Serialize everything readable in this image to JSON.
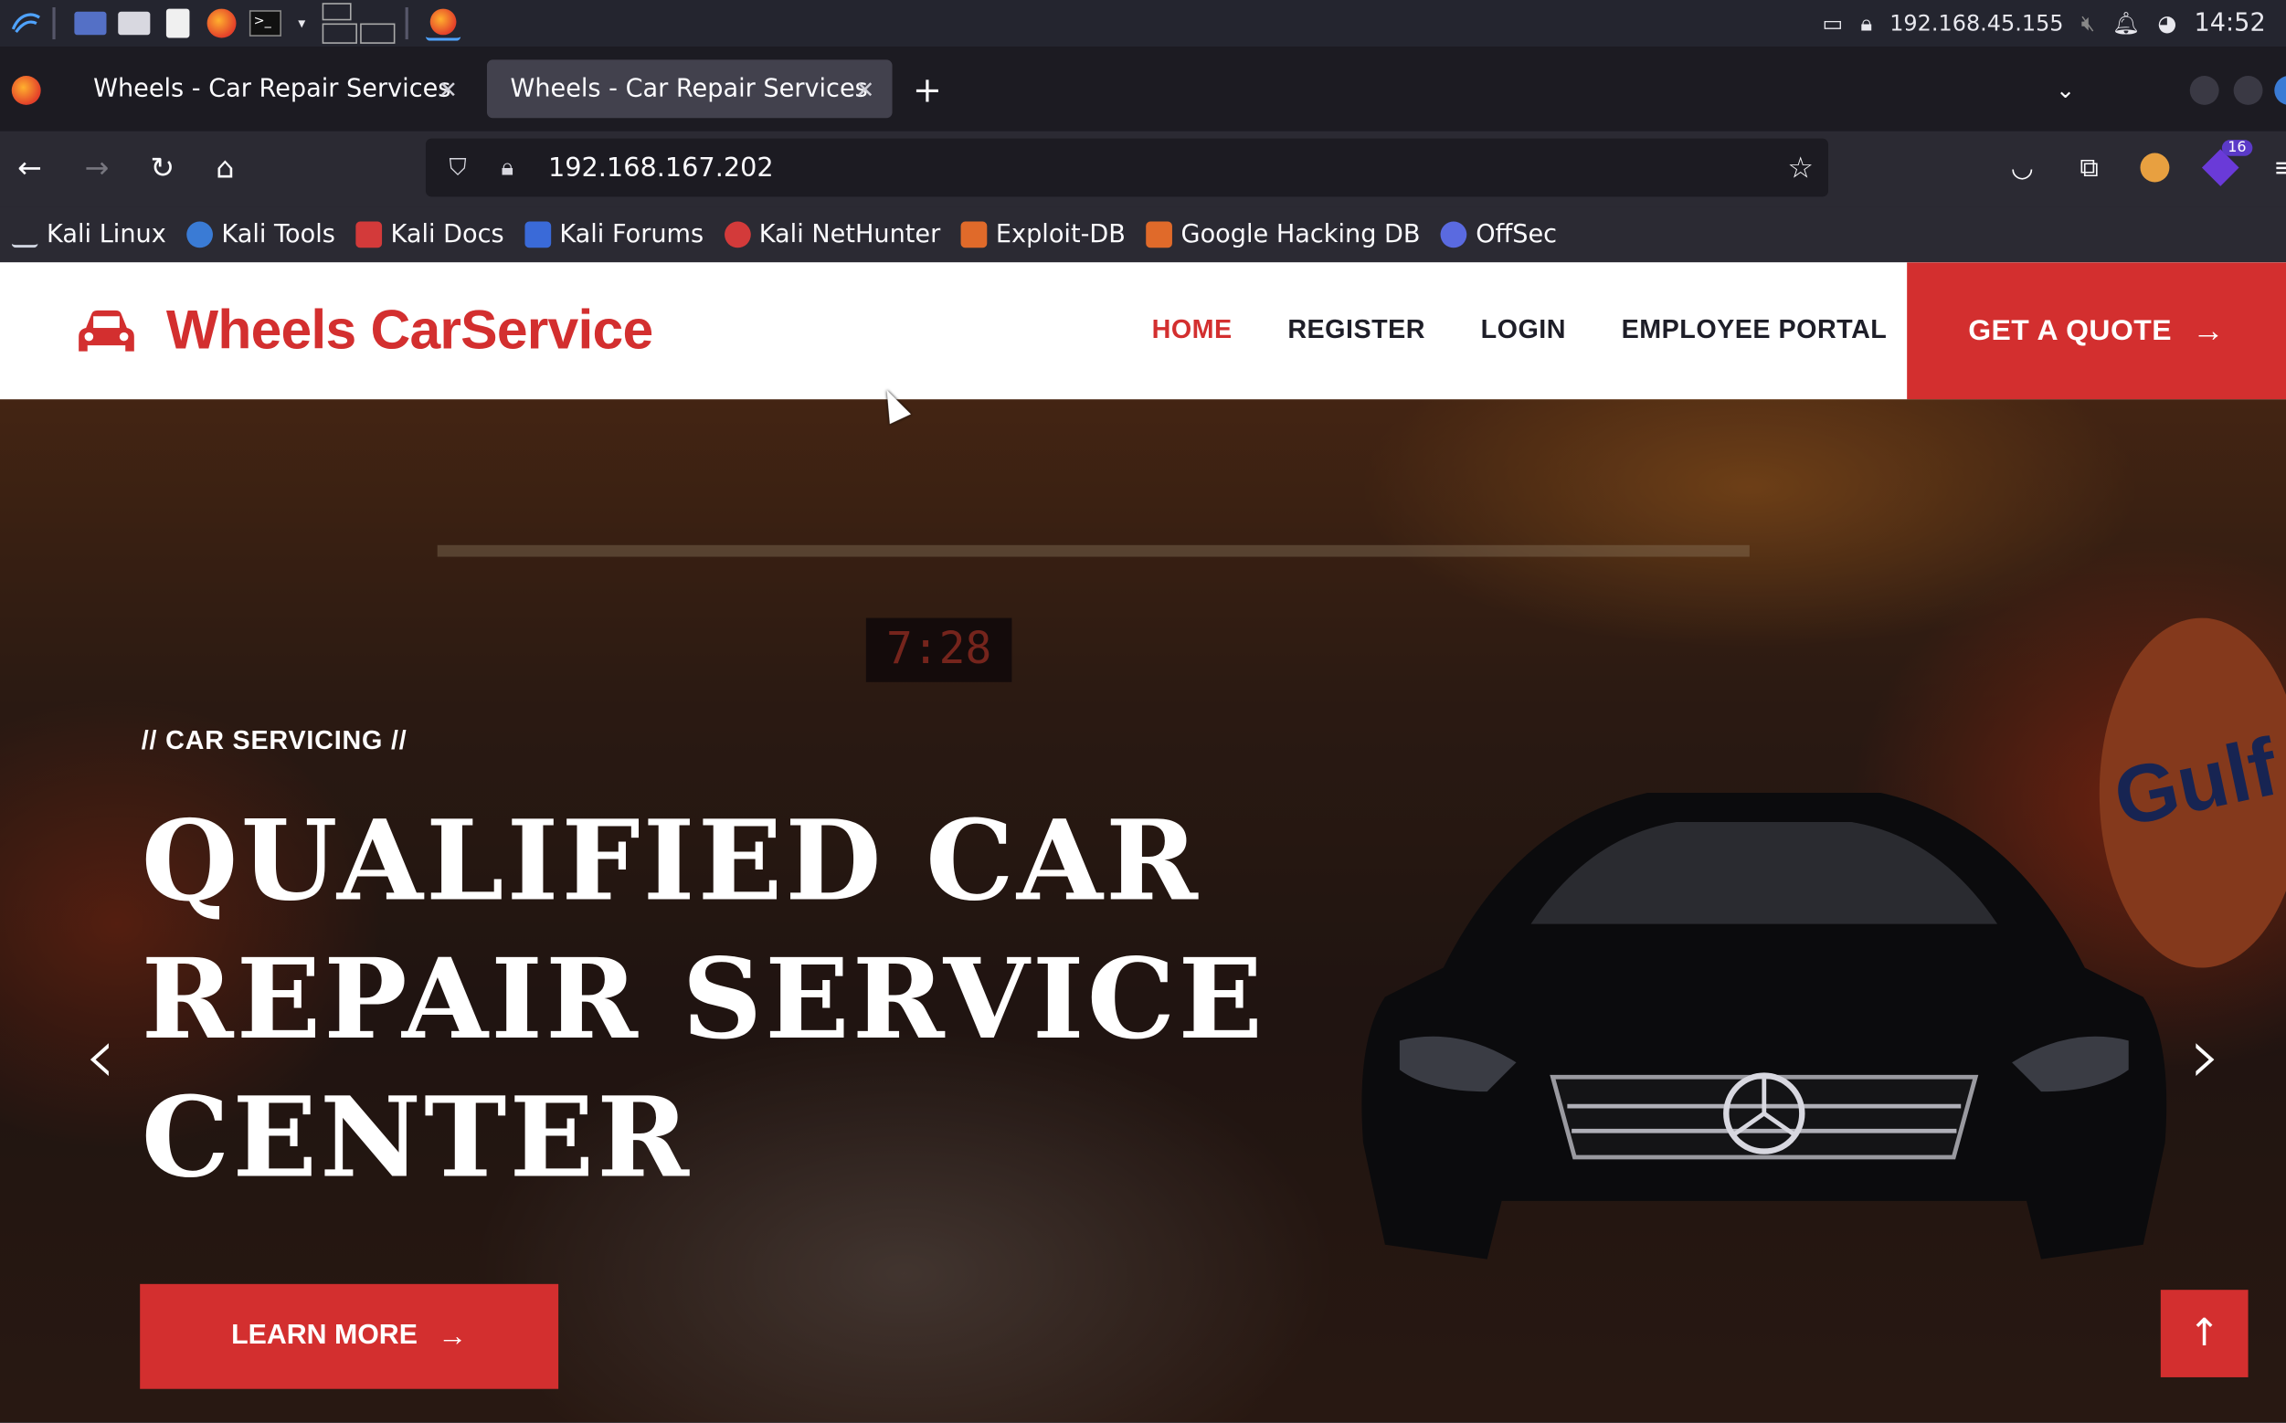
{
  "taskbar": {
    "ip_address": "192.168.45.155",
    "clock": "14:52"
  },
  "tabs": [
    {
      "title": "Wheels - Car Repair Services",
      "active": false
    },
    {
      "title": "Wheels - Car Repair Services",
      "active": true
    }
  ],
  "navbar": {
    "url": "192.168.167.202",
    "ext_badge": "16"
  },
  "bookmarks": [
    {
      "label": "Kali Linux",
      "icon": "kali-icon",
      "color": "#4a8fd8"
    },
    {
      "label": "Kali Tools",
      "icon": "kali-tools-icon",
      "color": "#d33a3a"
    },
    {
      "label": "Kali Docs",
      "icon": "kali-docs-icon",
      "color": "#d33a3a"
    },
    {
      "label": "Kali Forums",
      "icon": "kali-forums-icon",
      "color": "#3a6ad8"
    },
    {
      "label": "Kali NetHunter",
      "icon": "nethunter-icon",
      "color": "#d33a3a"
    },
    {
      "label": "Exploit-DB",
      "icon": "exploit-db-icon",
      "color": "#e06a2a"
    },
    {
      "label": "Google Hacking DB",
      "icon": "ghdb-icon",
      "color": "#e06a2a"
    },
    {
      "label": "OffSec",
      "icon": "offsec-icon",
      "color": "#5a6ae0"
    }
  ],
  "site": {
    "brand": "Wheels CarService",
    "nav": [
      "HOME",
      "REGISTER",
      "LOGIN",
      "EMPLOYEE PORTAL"
    ],
    "cta": "GET A QUOTE",
    "hero": {
      "eyebrow": "// CAR SERVICING //",
      "headline": "QUALIFIED CAR REPAIR SERVICE CENTER",
      "button": "LEARN MORE",
      "clock_sign": "7:28",
      "sign_text": "Gulf"
    }
  },
  "colors": {
    "accent": "#d32f2f",
    "browser_bg": "#2b2a33",
    "tab_active": "#42414d"
  }
}
